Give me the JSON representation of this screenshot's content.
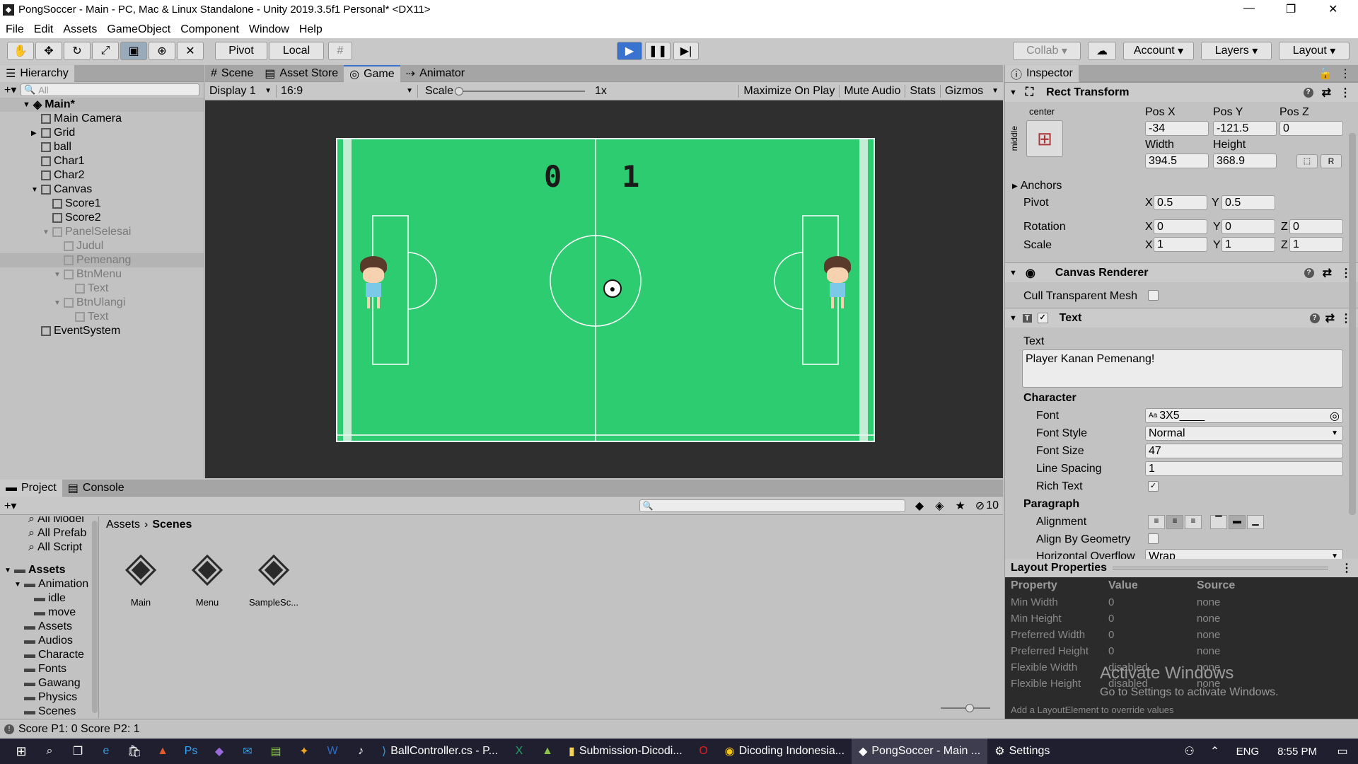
{
  "window": {
    "title": "PongSoccer - Main - PC, Mac & Linux Standalone - Unity 2019.3.5f1 Personal* <DX11>",
    "minimize": "—",
    "maximize": "❐",
    "close": "✕"
  },
  "menu": [
    "File",
    "Edit",
    "Assets",
    "GameObject",
    "Component",
    "Window",
    "Help"
  ],
  "toolbar": {
    "pivot": "Pivot",
    "local": "Local",
    "collab": "Collab",
    "account": "Account",
    "layers": "Layers",
    "layout": "Layout"
  },
  "hierarchy": {
    "tab": "Hierarchy",
    "search_placeholder": "All",
    "scene": "Main*",
    "items": [
      {
        "label": "Main Camera",
        "indent": 1,
        "dim": false,
        "arrow": ""
      },
      {
        "label": "Grid",
        "indent": 1,
        "dim": false,
        "arrow": "▶"
      },
      {
        "label": "ball",
        "indent": 1,
        "dim": false,
        "arrow": ""
      },
      {
        "label": "Char1",
        "indent": 1,
        "dim": false,
        "arrow": ""
      },
      {
        "label": "Char2",
        "indent": 1,
        "dim": false,
        "arrow": ""
      },
      {
        "label": "Canvas",
        "indent": 1,
        "dim": false,
        "arrow": "▼"
      },
      {
        "label": "Score1",
        "indent": 2,
        "dim": false,
        "arrow": ""
      },
      {
        "label": "Score2",
        "indent": 2,
        "dim": false,
        "arrow": ""
      },
      {
        "label": "PanelSelesai",
        "indent": 2,
        "dim": true,
        "arrow": "▼"
      },
      {
        "label": "Judul",
        "indent": 3,
        "dim": true,
        "arrow": ""
      },
      {
        "label": "Pemenang",
        "indent": 3,
        "dim": true,
        "arrow": "",
        "selected": true
      },
      {
        "label": "BtnMenu",
        "indent": 3,
        "dim": true,
        "arrow": "▼"
      },
      {
        "label": "Text",
        "indent": 4,
        "dim": true,
        "arrow": ""
      },
      {
        "label": "BtnUlangi",
        "indent": 3,
        "dim": true,
        "arrow": "▼"
      },
      {
        "label": "Text",
        "indent": 4,
        "dim": true,
        "arrow": ""
      },
      {
        "label": "EventSystem",
        "indent": 1,
        "dim": false,
        "arrow": ""
      }
    ]
  },
  "center_tabs": [
    "Scene",
    "Asset Store",
    "Game",
    "Animator"
  ],
  "game_bar": {
    "display": "Display 1",
    "aspect": "16:9",
    "scale_label": "Scale",
    "scale_value": "1x",
    "maximize": "Maximize On Play",
    "mute": "Mute Audio",
    "stats": "Stats",
    "gizmos": "Gizmos"
  },
  "game": {
    "score_left": "0",
    "score_right": "1"
  },
  "project": {
    "tabs": [
      "Project",
      "Console"
    ],
    "favorites": [
      "All Model",
      "All Prefab",
      "All Script"
    ],
    "tree": [
      {
        "label": "Assets",
        "indent": 0,
        "arrow": "▼",
        "bold": true
      },
      {
        "label": "Animation",
        "indent": 1,
        "arrow": "▼"
      },
      {
        "label": "idle",
        "indent": 2,
        "arrow": ""
      },
      {
        "label": "move",
        "indent": 2,
        "arrow": ""
      },
      {
        "label": "Assets",
        "indent": 1,
        "arrow": ""
      },
      {
        "label": "Audios",
        "indent": 1,
        "arrow": ""
      },
      {
        "label": "Characte",
        "indent": 1,
        "arrow": ""
      },
      {
        "label": "Fonts",
        "indent": 1,
        "arrow": ""
      },
      {
        "label": "Gawang",
        "indent": 1,
        "arrow": ""
      },
      {
        "label": "Physics",
        "indent": 1,
        "arrow": ""
      },
      {
        "label": "Scenes",
        "indent": 1,
        "arrow": ""
      }
    ],
    "breadcrumb": [
      "Assets",
      "Scenes"
    ],
    "files": [
      "Main",
      "Menu",
      "SampleSc..."
    ],
    "hidden_count": "10"
  },
  "inspector": {
    "tab": "Inspector",
    "rect_transform": {
      "title": "Rect Transform",
      "anchor_h": "center",
      "anchor_v": "middle",
      "labels": [
        "Pos X",
        "Pos Y",
        "Pos Z",
        "Width",
        "Height"
      ],
      "pos_x": "-34",
      "pos_y": "-121.5",
      "pos_z": "0",
      "width": "394.5",
      "height": "368.9",
      "anchors": "Anchors",
      "pivot": "Pivot",
      "pivot_x": "0.5",
      "pivot_y": "0.5",
      "rotation": "Rotation",
      "rot_x": "0",
      "rot_y": "0",
      "rot_z": "0",
      "scale": "Scale",
      "scale_x": "1",
      "scale_y": "1",
      "scale_z": "1",
      "r_btn": "R"
    },
    "canvas_renderer": {
      "title": "Canvas Renderer",
      "cull": "Cull Transparent Mesh"
    },
    "text": {
      "title": "Text",
      "text_label": "Text",
      "value": "Player Kanan Pemenang!",
      "character": "Character",
      "font_label": "Font",
      "font": "3X5____",
      "font_style_label": "Font Style",
      "font_style": "Normal",
      "font_size_label": "Font Size",
      "font_size": "47",
      "line_spacing_label": "Line Spacing",
      "line_spacing": "1",
      "rich_text_label": "Rich Text",
      "paragraph": "Paragraph",
      "alignment": "Alignment",
      "align_geometry": "Align By Geometry",
      "horizontal_overflow": "Horizontal Overflow",
      "wrap": "Wrap"
    }
  },
  "layout_props": {
    "title": "Layout Properties",
    "headers": [
      "Property",
      "Value",
      "Source"
    ],
    "rows": [
      [
        "Min Width",
        "0",
        "none"
      ],
      [
        "Min Height",
        "0",
        "none"
      ],
      [
        "Preferred Width",
        "0",
        "none"
      ],
      [
        "Preferred Height",
        "0",
        "none"
      ],
      [
        "Flexible Width",
        "disabled",
        "none"
      ],
      [
        "Flexible Height",
        "disabled",
        "none"
      ]
    ],
    "footer": "Add a LayoutElement to override values",
    "watermark_1": "Activate Windows",
    "watermark_2": "Go to Settings to activate Windows."
  },
  "status": "Score P1: 0 Score P2: 1",
  "taskbar": {
    "apps": [
      "BallController.cs - P...",
      "Submission-Dicodi...",
      "Dicoding Indonesia...",
      "PongSoccer - Main ...",
      "Settings"
    ],
    "lang": "ENG",
    "time": "8:55 PM"
  }
}
